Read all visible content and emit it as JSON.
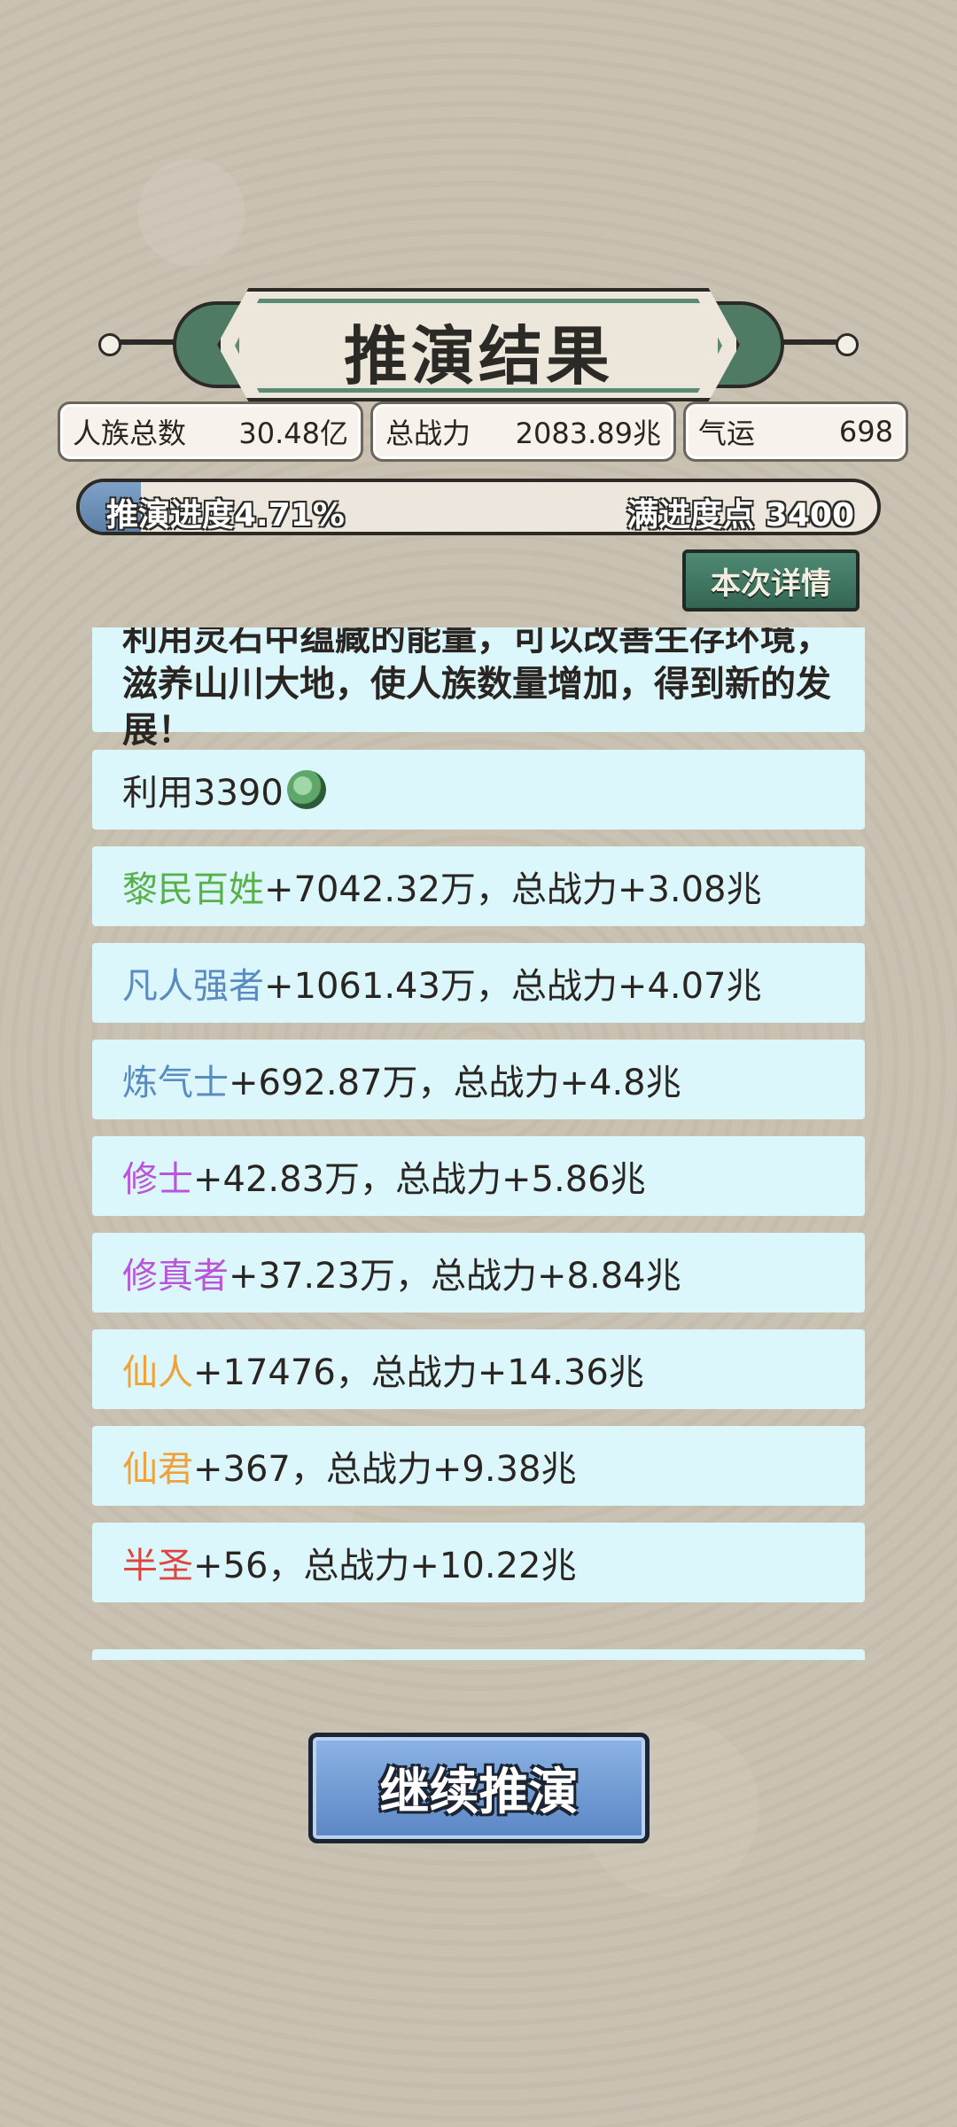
{
  "title": "推演结果",
  "stats": {
    "population_label": "人族总数",
    "population_value": "30.48亿",
    "power_label": "总战力",
    "power_value": "2083.89兆",
    "luck_label": "气运",
    "luck_value": "698"
  },
  "progress": {
    "left_text": "推演进度4.71%",
    "right_text": "满进度点 3400",
    "fraction": 0.0471
  },
  "details_button": "本次详情",
  "intro_text": "利用灵石中蕴藏的能量，可以改善生存环境，滋养山川大地，使人族数量增加，得到新的发展！",
  "use_line": {
    "prefix": "利用3390",
    "icon": "spirit-stone-icon"
  },
  "results": [
    {
      "name": "黎民百姓",
      "rest": "+7042.32万，总战力+3.08兆",
      "color": "#57b04a"
    },
    {
      "name": "凡人强者",
      "rest": "+1061.43万，总战力+4.07兆",
      "color": "#5a8bc0"
    },
    {
      "name": "炼气士",
      "rest": "+692.87万，总战力+4.8兆",
      "color": "#5a8bc0"
    },
    {
      "name": "修士",
      "rest": "+42.83万，总战力+5.86兆",
      "color": "#b955d9"
    },
    {
      "name": "修真者",
      "rest": "+37.23万，总战力+8.84兆",
      "color": "#b955d9"
    },
    {
      "name": "仙人",
      "rest": "+17476，总战力+14.36兆",
      "color": "#efa13a"
    },
    {
      "name": "仙君",
      "rest": "+367，总战力+9.38兆",
      "color": "#efa13a"
    },
    {
      "name": "半圣",
      "rest": "+56，总战力+10.22兆",
      "color": "#e0443f"
    }
  ],
  "continue_button": "继续推演"
}
